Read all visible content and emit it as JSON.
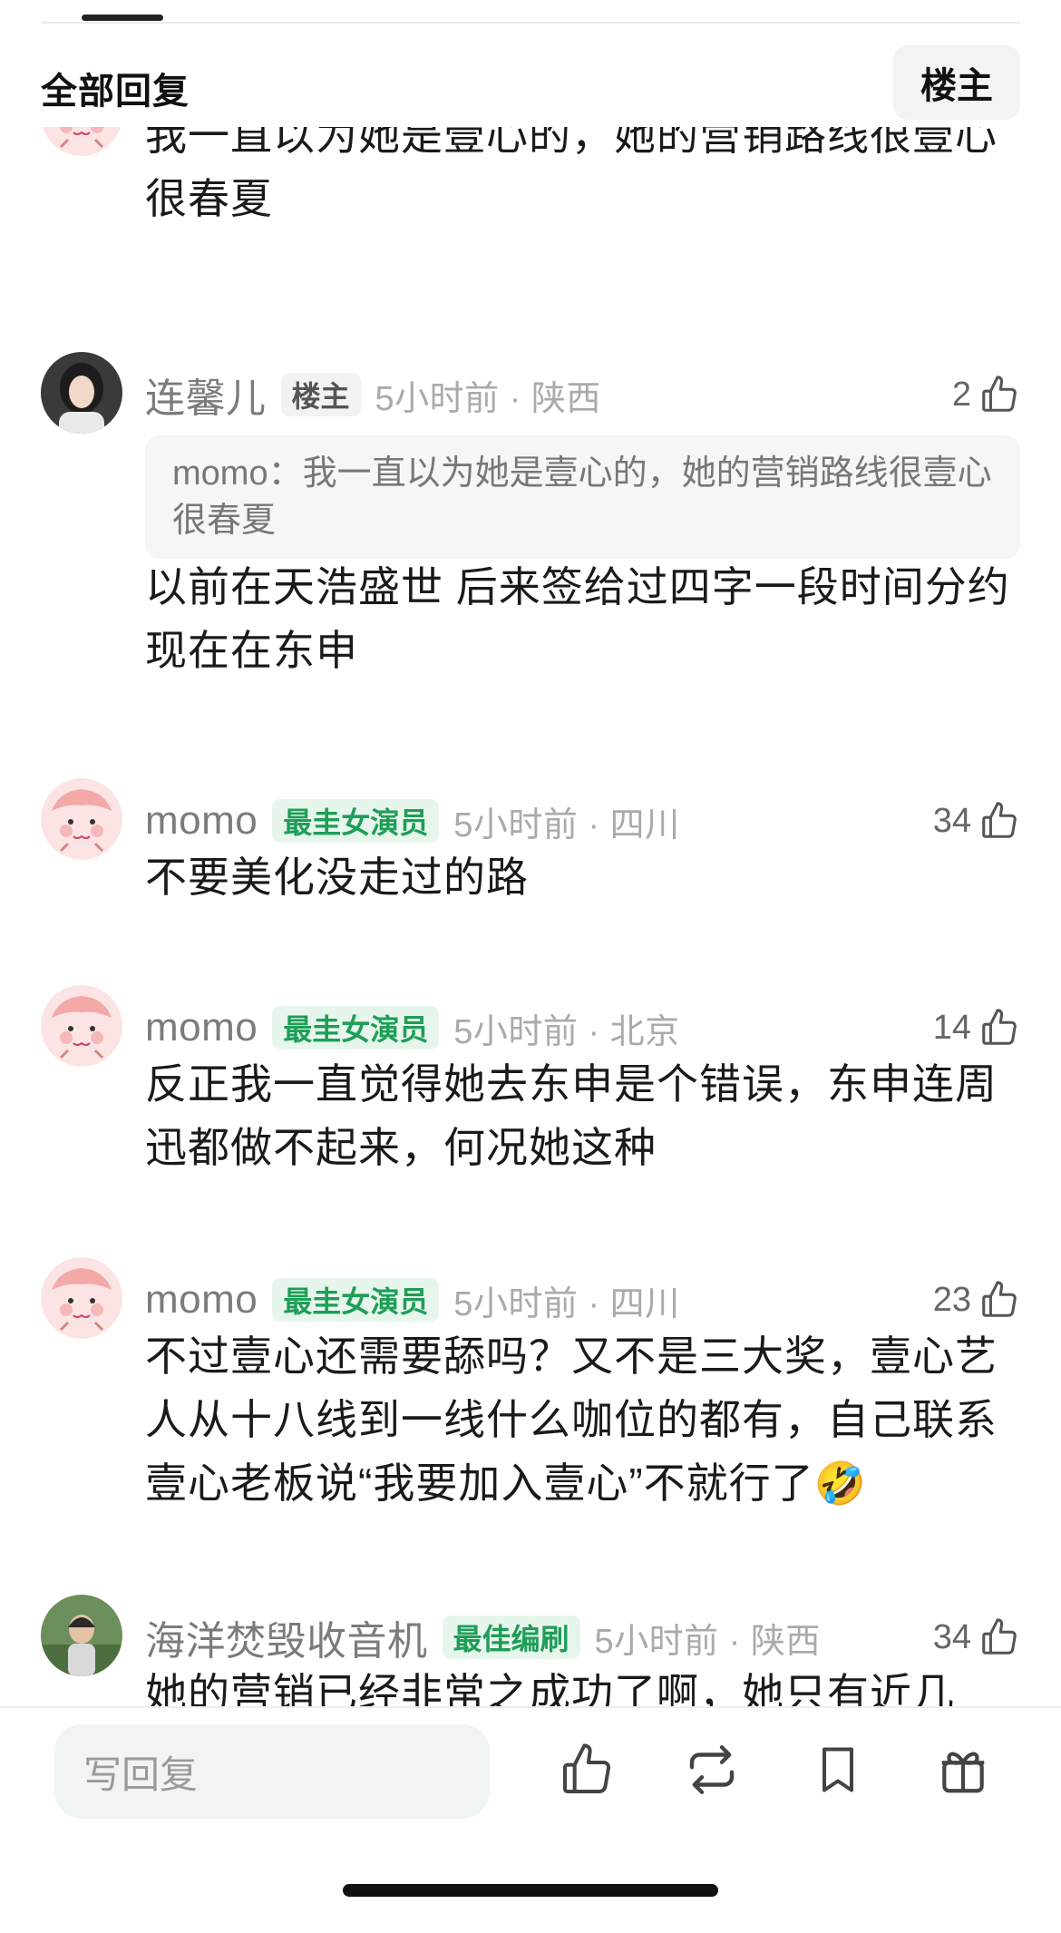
{
  "header": {
    "title": "全部回复",
    "op_button": "楼主"
  },
  "comments": [
    {
      "name": "",
      "body": "我一直以为她是壹心的，她的营销路线很壹心很春夏",
      "avatar": "cartoon-peach-avatar"
    },
    {
      "name": "连馨儿",
      "badge": "楼主",
      "time_loc": "5小时前 · 陕西",
      "likes": "2",
      "quote": "momo：我一直以为她是壹心的，她的营销路线很壹心很春夏",
      "body": "以前在天浩盛世 后来签给过四字一段时间分约 现在在东申",
      "avatar": "photo-woman-avatar"
    },
    {
      "name": "momo",
      "badge": "最圭女演员",
      "time_loc": "5小时前 · 四川",
      "likes": "34",
      "body": "不要美化没走过的路",
      "avatar": "cartoon-peach-avatar"
    },
    {
      "name": "momo",
      "badge": "最圭女演员",
      "time_loc": "5小时前 · 北京",
      "likes": "14",
      "body": "反正我一直觉得她去东申是个错误，东申连周迅都做不起来，何况她这种",
      "avatar": "cartoon-peach-avatar"
    },
    {
      "name": "momo",
      "badge": "最圭女演员",
      "time_loc": "5小时前 · 四川",
      "likes": "23",
      "body": "不过壹心还需要舔吗？又不是三大奖，壹心艺人从十八线到一线什么咖位的都有，自己联系壹心老板说“我要加入壹心”不就行了",
      "emoji": "🤣",
      "avatar": "cartoon-peach-avatar"
    },
    {
      "name": "海洋焚毁收音机",
      "badge": "最佳编刷",
      "time_loc": "5小时前 · 陕西",
      "likes": "34",
      "body": "她的营销已经非常之成功了啊，她只有近几",
      "avatar": "photo-outdoor-avatar"
    }
  ],
  "bottom_bar": {
    "reply_placeholder": "写回复",
    "icons": [
      "thumbs-up-icon",
      "repost-icon",
      "bookmark-icon",
      "gift-icon"
    ]
  }
}
